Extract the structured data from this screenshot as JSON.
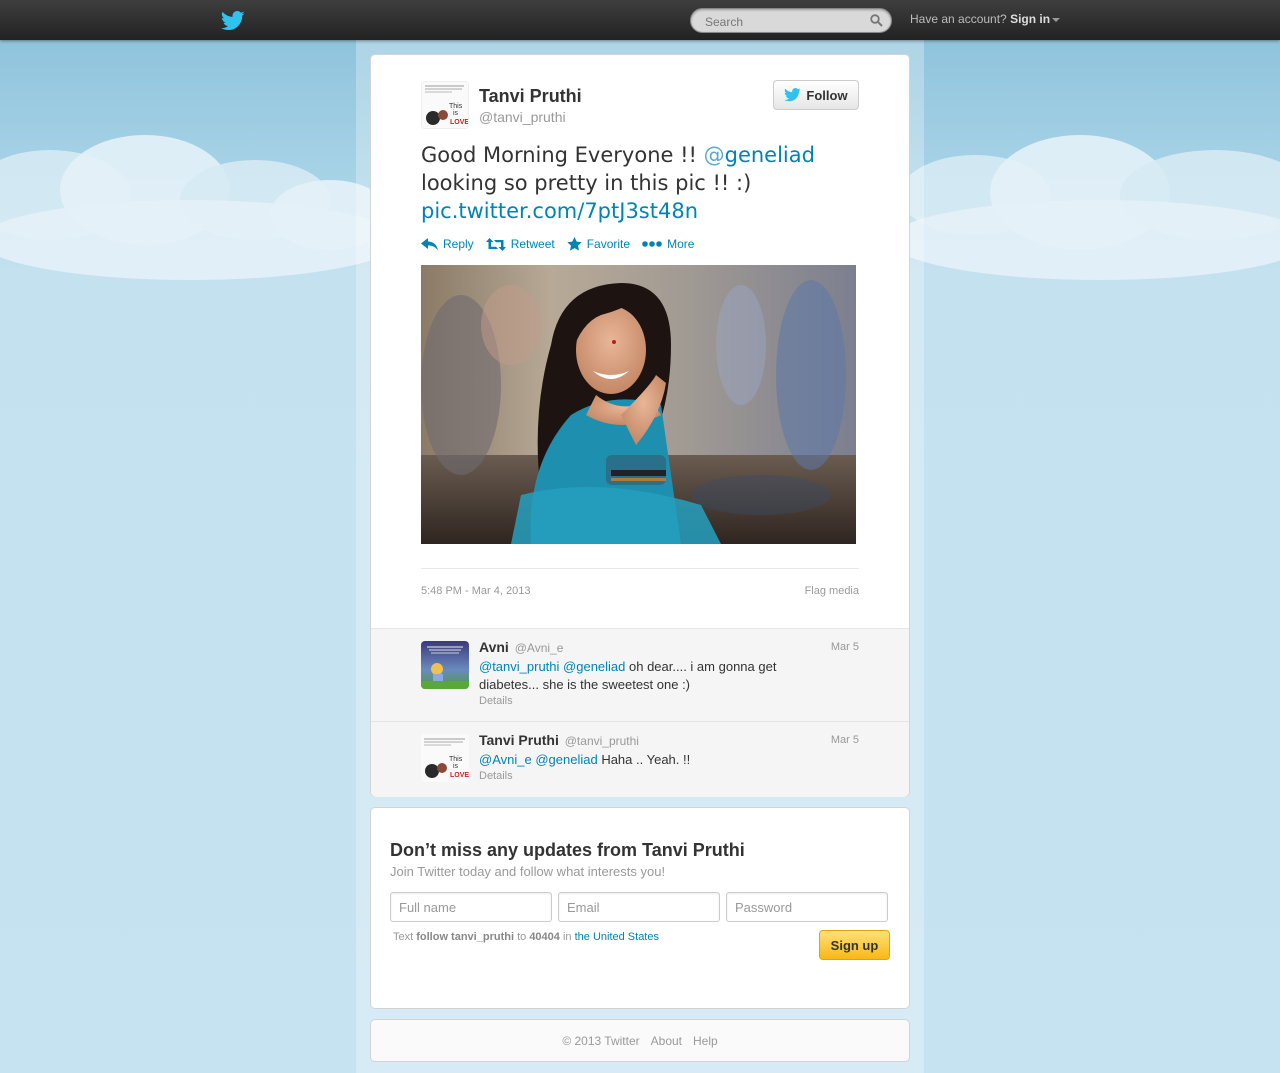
{
  "colors": {
    "link": "#0084b4",
    "topbar": "#2b2b2b",
    "sky": "#c0deed",
    "signup_button": "#f8b818"
  },
  "topbar": {
    "logo_icon": "twitter-bird-icon",
    "search_placeholder": "Search",
    "search_icon": "magnifier-icon",
    "account_prompt": "Have an account?",
    "sign_in_label": "Sign in"
  },
  "tweet": {
    "author_name": "Tanvi Pruthi",
    "author_handle": "@tanvi_pruthi",
    "follow_label": "Follow",
    "text_part1": "Good Morning Everyone !! ",
    "mention_at": "@",
    "mention": "geneliad",
    "text_part2": " looking so pretty in this pic !! :) ",
    "link": "pic.twitter.com/7ptJ3st48n",
    "actions": {
      "reply": "Reply",
      "retweet": "Retweet",
      "favorite": "Favorite",
      "more": "More"
    },
    "timestamp": "5:48 PM - Mar 4, 2013",
    "flag_label": "Flag media"
  },
  "replies": [
    {
      "name": "Avni",
      "handle": "@Avni_e",
      "date": "Mar 5",
      "mention1": "@tanvi_pruthi",
      "mention2": "@geneliad",
      "text": " oh dear.... i am gonna get diabetes... she is the sweetest one :)",
      "details": "Details"
    },
    {
      "name": "Tanvi Pruthi",
      "handle": "@tanvi_pruthi",
      "date": "Mar 5",
      "mention1": "@Avni_e",
      "mention2": "@geneliad",
      "text": " Haha .. Yeah. !!",
      "details": "Details"
    }
  ],
  "signup": {
    "title": "Don’t miss any updates from Tanvi Pruthi",
    "subtitle": "Join Twitter today and follow what interests you!",
    "fullname_placeholder": "Full name",
    "email_placeholder": "Email",
    "password_placeholder": "Password",
    "sms_text1": "Text ",
    "sms_command": "follow tanvi_pruthi",
    "sms_text2": " to ",
    "sms_number": "40404",
    "sms_text3": " in ",
    "sms_country": "the United States",
    "button_label": "Sign up"
  },
  "footer": {
    "copyright": "© 2013 Twitter",
    "about": "About",
    "help": "Help"
  }
}
